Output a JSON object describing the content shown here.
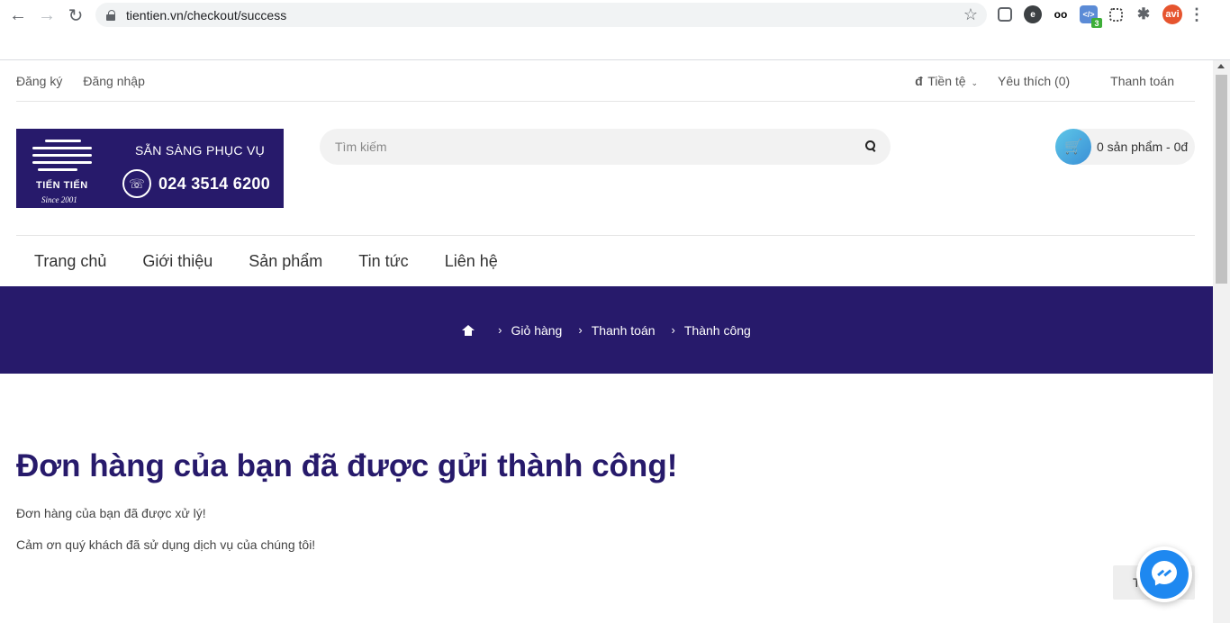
{
  "browser": {
    "url": "tientien.vn/checkout/success",
    "back_glyph": "←",
    "forward_glyph": "→",
    "reload_glyph": "↻",
    "star_glyph": "☆",
    "extensions": [
      {
        "name": "screenshot-extension-icon",
        "glyph": ""
      },
      {
        "name": "edge-extension-icon",
        "glyph": "e"
      },
      {
        "name": "tripadvisor-extension-icon",
        "glyph": "oo"
      },
      {
        "name": "code-extension-icon",
        "glyph": "</>",
        "badge": "3"
      },
      {
        "name": "qr-extension-icon",
        "glyph": ""
      },
      {
        "name": "puzzle-extensions-icon",
        "glyph": "✱"
      },
      {
        "name": "avi-extension-icon",
        "glyph": "avi"
      },
      {
        "name": "menu-dots-icon",
        "glyph": "⋮"
      }
    ]
  },
  "topbar": {
    "register": "Đăng ký",
    "login": "Đăng nhập",
    "currency_symbol": "đ",
    "currency": "Tiền tệ",
    "wishlist": "Yêu thích (0)",
    "checkout": "Thanh toán"
  },
  "logo": {
    "brand": "TIẾN TIẾN",
    "since": "Since 2001",
    "slogan": "SẴN SÀNG PHỤC VỤ",
    "phone": "024 3514 6200"
  },
  "search": {
    "placeholder": "Tìm kiếm"
  },
  "cart": {
    "summary": "0 sản phẩm - 0đ"
  },
  "nav": {
    "items": [
      "Trang chủ",
      "Giới thiệu",
      "Sản phẩm",
      "Tin tức",
      "Liên hệ"
    ]
  },
  "breadcrumb": {
    "items": [
      "Giỏ hàng",
      "Thanh toán",
      "Thành công"
    ],
    "separator": "›"
  },
  "content": {
    "heading": "Đơn hàng của bạn đã được gửi thành công!",
    "message1": "Đơn hàng của bạn đã được xử lý!",
    "message2": "Cảm ơn quý khách đã sử dụng dịch vụ của chúng tôi!",
    "continue_label": "T"
  },
  "colors": {
    "brand": "#271a6b",
    "messenger": "#1e88f0"
  }
}
